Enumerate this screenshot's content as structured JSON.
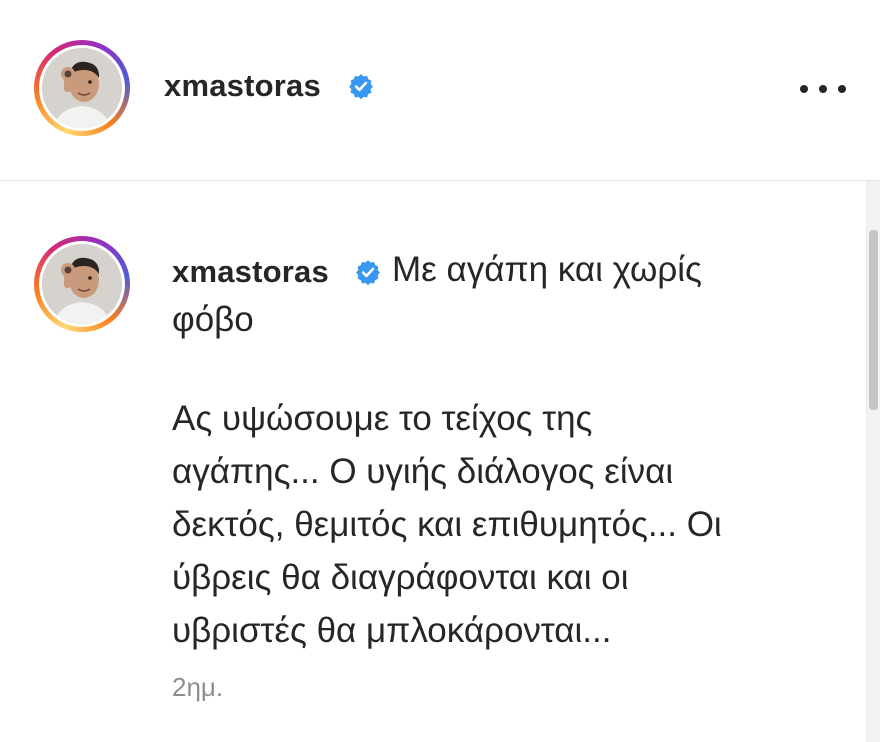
{
  "header": {
    "username": "xmastoras",
    "verified_icon": "verified-badge-icon",
    "more_icon": "more-options-icon"
  },
  "comment": {
    "username": "xmastoras",
    "caption_first_line": "Με αγάπη και χωρίς",
    "caption_second_line": "φόβο",
    "body_lines": [
      "Ας υψώσουμε το τείχος της",
      "αγάπης... Ο υγιής διάλογος είναι",
      "δεκτός, θεμιτός και επιθυμητός... Οι",
      "ύβρεις θα διαγράφονται και οι",
      "υβριστές θα μπλοκάρονται..."
    ],
    "timestamp": "2ημ."
  },
  "colors": {
    "verified_blue": "#3897f0",
    "text": "#262626",
    "muted": "#8e8e8e"
  }
}
